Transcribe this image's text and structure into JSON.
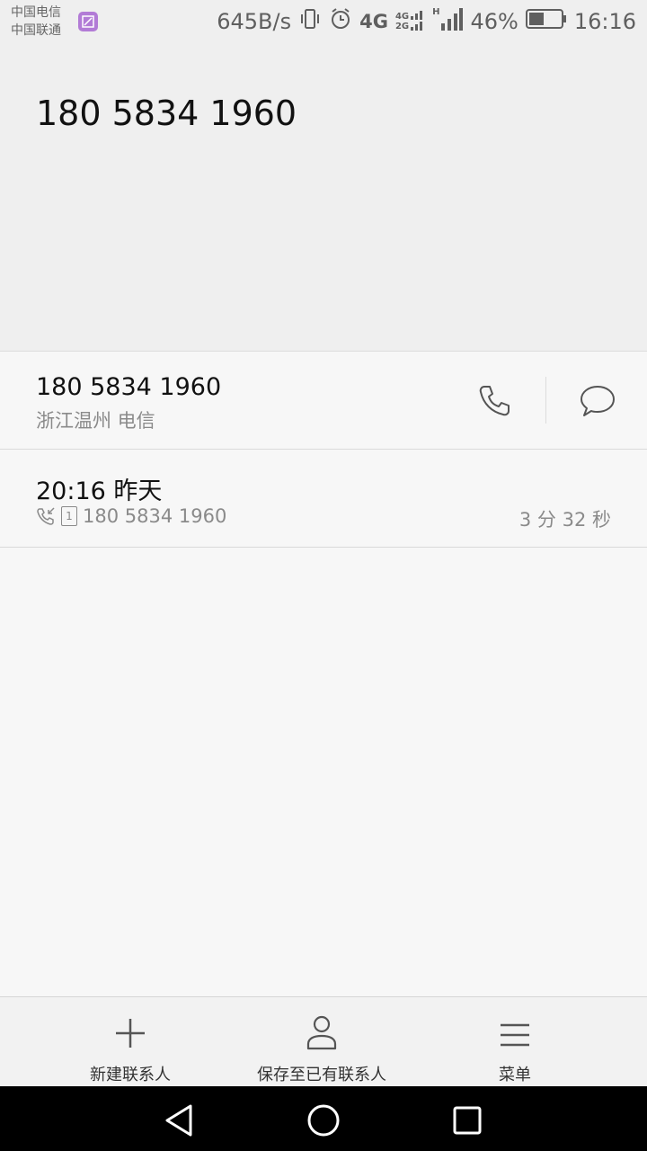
{
  "status_bar": {
    "carrier_1": "中国电信",
    "carrier_2": "中国联通",
    "net_speed": "645B/s",
    "net_type_1": "4G",
    "net_type_2a": "4G",
    "net_type_2b": "2G",
    "net_type_3": "H",
    "battery": "46%",
    "battery_level": 0.46,
    "time": "16:16"
  },
  "header": {
    "phone_number": "180 5834 1960"
  },
  "number_row": {
    "number": "180 5834 1960",
    "location": "浙江温州 电信",
    "call_icon": "phone-icon",
    "message_icon": "message-icon"
  },
  "call_log": [
    {
      "time": "20:16 昨天",
      "sim": "1",
      "number": "180 5834 1960",
      "duration": "3 分 32 秒",
      "type_icon": "incoming-call-icon"
    }
  ],
  "bottom_bar": {
    "new_contact": "新建联系人",
    "save_existing": "保存至已有联系人",
    "menu": "菜单"
  },
  "colors": {
    "header_bg": "#efefef",
    "list_bg": "#f7f7f7",
    "sim_badge": "#b27bd6"
  }
}
